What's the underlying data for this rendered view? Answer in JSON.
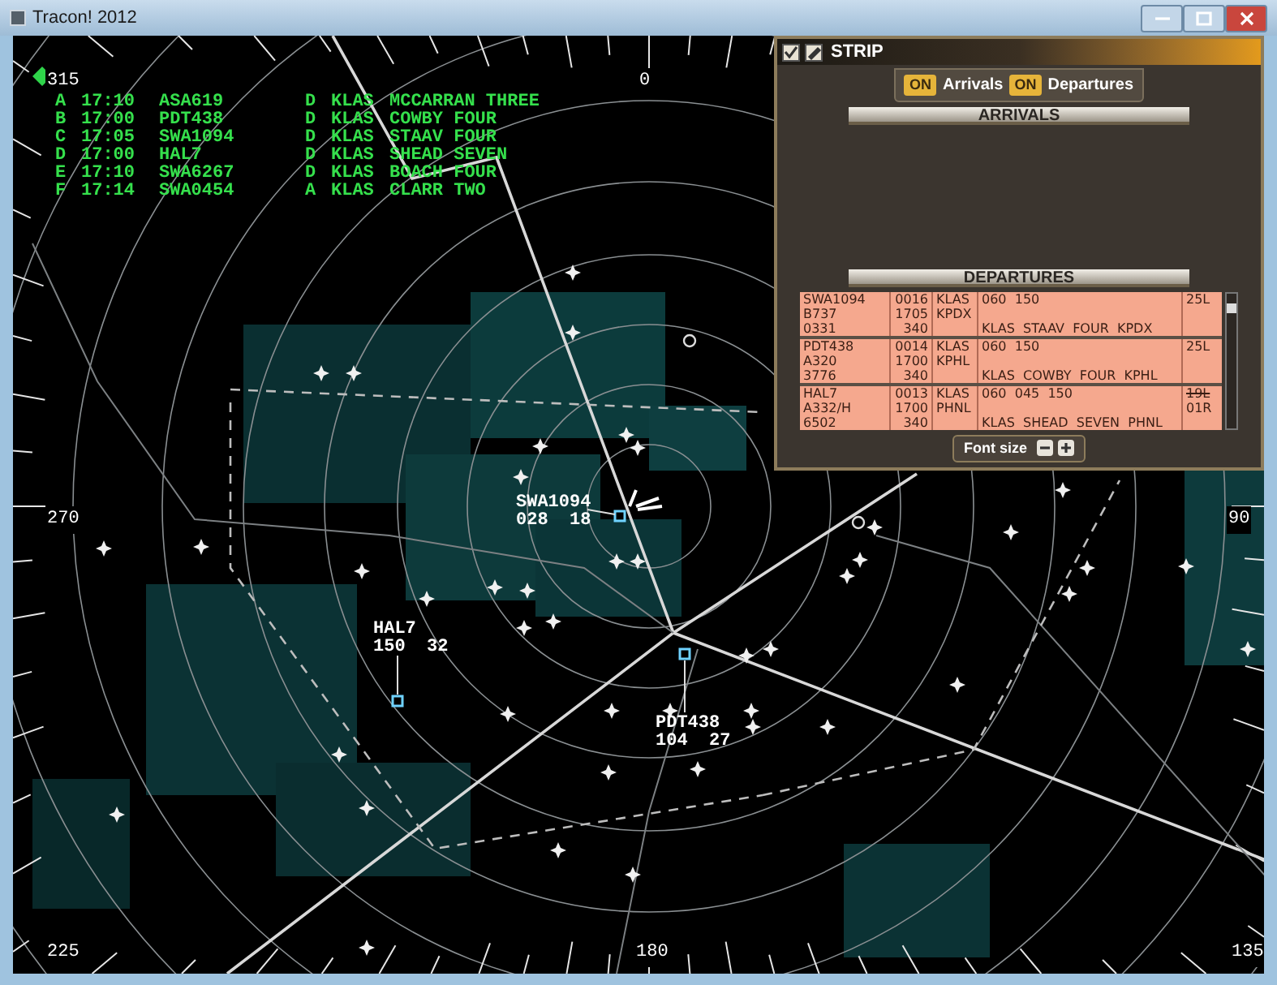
{
  "window": {
    "title": "Tracon! 2012"
  },
  "flight_list": [
    {
      "letter": "A",
      "time": "17:10",
      "callsign": "ASA619",
      "type": "D",
      "airport": "KLAS",
      "procedure": "MCCARRAN THREE"
    },
    {
      "letter": "B",
      "time": "17:00",
      "callsign": "PDT438",
      "type": "D",
      "airport": "KLAS",
      "procedure": "COWBY FOUR"
    },
    {
      "letter": "C",
      "time": "17:05",
      "callsign": "SWA1094",
      "type": "D",
      "airport": "KLAS",
      "procedure": "STAAV FOUR"
    },
    {
      "letter": "D",
      "time": "17:00",
      "callsign": "HAL7",
      "type": "D",
      "airport": "KLAS",
      "procedure": "SHEAD SEVEN"
    },
    {
      "letter": "E",
      "time": "17:10",
      "callsign": "SWA6267",
      "type": "D",
      "airport": "KLAS",
      "procedure": "BOACH FOUR"
    },
    {
      "letter": "F",
      "time": "17:14",
      "callsign": "SWA0454",
      "type": "A",
      "airport": "KLAS",
      "procedure": "CLARR TWO"
    }
  ],
  "compass": [
    {
      "label": "315"
    },
    {
      "label": "0"
    },
    {
      "label": "270"
    },
    {
      "label": "90"
    },
    {
      "label": "225"
    },
    {
      "label": "180"
    },
    {
      "label": "135"
    }
  ],
  "aircraft": [
    {
      "callsign": "SWA1094",
      "data": "028  18"
    },
    {
      "callsign": "HAL7",
      "data": "150  32"
    },
    {
      "callsign": "PDT438",
      "data": "104  27"
    }
  ],
  "strip_panel": {
    "title": "STRIP",
    "toggles": [
      {
        "badge": "ON",
        "label": "Arrivals",
        "on": true
      },
      {
        "badge": "ON",
        "label": "Departures",
        "on": true
      }
    ],
    "sections": [
      {
        "title": "ARRIVALS"
      },
      {
        "title": "DEPARTURES",
        "strips": [
          {
            "callsign": "SWA1094",
            "aircraft": "B737",
            "squawk": "0331",
            "number": "0016",
            "time": "1705",
            "altitude": "340",
            "origin": "KLAS",
            "destination": "KPDX",
            "headings": "060  150",
            "route": "KLAS  STAAV  FOUR  KPDX",
            "runways": [
              {
                "text": "25L",
                "struck": false
              }
            ]
          },
          {
            "callsign": "PDT438",
            "aircraft": "A320",
            "squawk": "3776",
            "number": "0014",
            "time": "1700",
            "altitude": "340",
            "origin": "KLAS",
            "destination": "KPHL",
            "headings": "060  150",
            "route": "KLAS  COWBY  FOUR  KPHL",
            "runways": [
              {
                "text": "25L",
                "struck": false
              }
            ]
          },
          {
            "callsign": "HAL7",
            "aircraft": "A332/H",
            "squawk": "6502",
            "number": "0013",
            "time": "1700",
            "altitude": "340",
            "origin": "KLAS",
            "destination": "PHNL",
            "headings": "060  045  150",
            "route": "KLAS  SHEAD  SEVEN  PHNL",
            "runways": [
              {
                "text": "19L",
                "struck": true
              },
              {
                "text": "01R",
                "struck": false
              }
            ]
          }
        ]
      }
    ],
    "font_size_label": "Font size"
  }
}
